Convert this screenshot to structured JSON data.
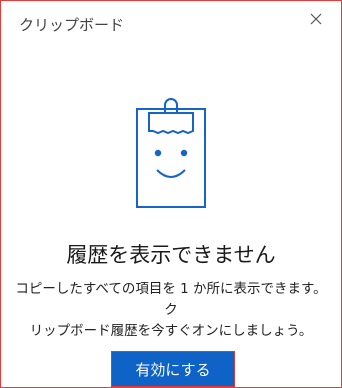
{
  "header": {
    "title": "クリップボード",
    "close_icon": "close-icon"
  },
  "empty_state": {
    "illustration_icon": "clipboard-smile-icon",
    "title": "履歴を表示できません",
    "description_line1": "コピーしたすべての項目を 1 か所に表示できます。ク",
    "description_line2": "リップボード履歴を今すぐオンにしましょう。"
  },
  "actions": {
    "enable_label": "有効にする"
  },
  "colors": {
    "accent": "#0f62c6",
    "highlight_border": "#e63b3b"
  }
}
